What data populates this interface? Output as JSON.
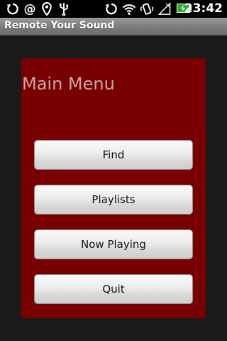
{
  "status_bar": {
    "time": "23:42",
    "icons_left": [
      "sync-icon",
      "at-icon",
      "location-icon",
      "usb-icon"
    ],
    "icons_right": [
      "sync-icon",
      "wifi-icon",
      "vibrate-icon",
      "signal-icon",
      "battery-charging-icon"
    ]
  },
  "app": {
    "title": "Remote Your Sound"
  },
  "main_menu": {
    "heading": "Main Menu",
    "buttons": {
      "find": "Find",
      "playlists": "Playlists",
      "now_playing": "Now Playing",
      "quit": "Quit"
    }
  },
  "colors": {
    "panel_background": "#780000",
    "window_background": "#1a1a1a"
  }
}
